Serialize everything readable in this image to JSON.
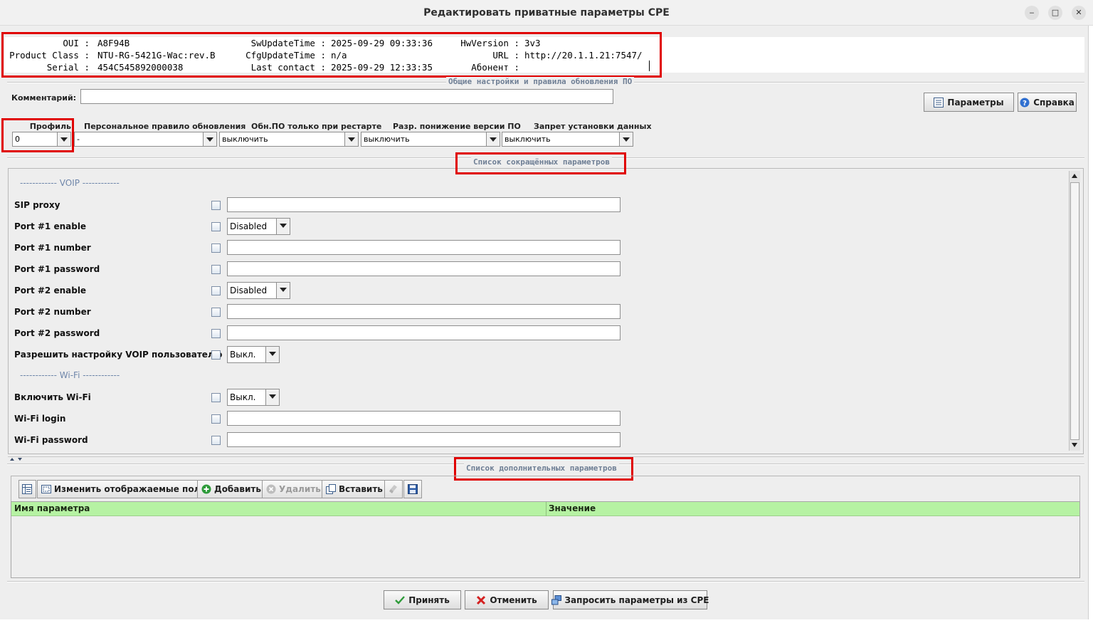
{
  "window": {
    "title": "Редактировать приватные параметры CPE",
    "minimize_glyph": "‒",
    "maximize_glyph": "□",
    "close_glyph": "✕"
  },
  "device_info": {
    "oui_label": "OUI",
    "oui": "A8F94B",
    "product_class_label": "Product Class",
    "product_class": "NTU-RG-5421G-Wac:rev.B",
    "serial_label": "Serial",
    "serial": "454C545892000038",
    "sw_update_label": "SwUpdateTime",
    "sw_update": "2025-09-29 09:33:36",
    "cfg_update_label": "CfgUpdateTime",
    "cfg_update": "n/a",
    "last_contact_label": "Last contact",
    "last_contact": "2025-09-29 12:33:35",
    "hw_version_label": "HwVersion",
    "hw_version": "3v3",
    "url_label": "URL",
    "url": "http://20.1.1.21:7547/",
    "subscriber_label": "Абонент",
    "subscriber": ""
  },
  "general": {
    "group_title": "Общие настройки и правила обновления ПО",
    "comment_label": "Комментарий:",
    "comment_value": "",
    "params_button": "Параметры",
    "help_button": "Справка",
    "profile_label": "Профиль",
    "profile_value": "0",
    "personal_rule_label": "Персональное правило обновления",
    "personal_rule_value": "-",
    "update_on_restart_label": "Обн.ПО только при рестарте",
    "update_on_restart_value": "выключить",
    "allow_downgrade_label": "Разр. понижение версии ПО",
    "allow_downgrade_value": "выключить",
    "data_install_ban_label": "Запрет установки данных",
    "data_install_ban_value": "выключить"
  },
  "short_params": {
    "title": "Список сокращённых параметров",
    "voip_separator": "------------ VOIP ------------",
    "wifi_separator": "------------ Wi-Fi ------------",
    "rows": [
      {
        "label": "SIP proxy",
        "type": "text",
        "value": ""
      },
      {
        "label": "Port #1 enable",
        "type": "combo",
        "value": "Disabled"
      },
      {
        "label": "Port #1 number",
        "type": "text",
        "value": ""
      },
      {
        "label": "Port #1 password",
        "type": "text",
        "value": ""
      },
      {
        "label": "Port #2 enable",
        "type": "combo",
        "value": "Disabled"
      },
      {
        "label": "Port #2 number",
        "type": "text",
        "value": ""
      },
      {
        "label": "Port #2 password",
        "type": "text",
        "value": ""
      },
      {
        "label": "Разрешить настройку VOIP пользователю",
        "type": "combo",
        "value": "Выкл."
      },
      {
        "label": "Включить Wi-Fi",
        "type": "combo",
        "value": "Выкл."
      },
      {
        "label": "Wi-Fi login",
        "type": "text",
        "value": ""
      },
      {
        "label": "Wi-Fi password",
        "type": "text",
        "value": ""
      }
    ]
  },
  "extra_params": {
    "title": "Список дополнительных параметров",
    "toolbar": {
      "change_fields": "Изменить отображаемые поля",
      "add": "Добавить",
      "delete": "Удалить",
      "paste": "Вставить"
    },
    "columns": [
      "Имя параметра",
      "Значение"
    ]
  },
  "footer": {
    "accept": "Принять",
    "cancel": "Отменить",
    "request": "Запросить параметры из CPE"
  },
  "colors": {
    "highlight_border": "#e00000",
    "table_header": "#b6f2a3",
    "group_title": "#6f7f95"
  }
}
